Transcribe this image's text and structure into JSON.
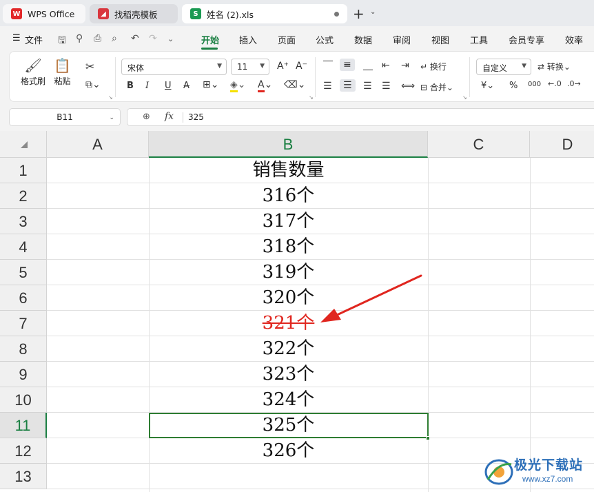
{
  "titlebar": {
    "tabs": [
      {
        "label": "WPS Office",
        "icon": "wps-logo-icon"
      },
      {
        "label": "找稻壳模板",
        "icon": "docer-icon"
      },
      {
        "label": "姓名 (2).xls",
        "icon": "spreadsheet-icon",
        "badge": "S"
      }
    ],
    "add_tab": "+"
  },
  "menubar": {
    "file": "文件",
    "items": [
      "开始",
      "插入",
      "页面",
      "公式",
      "数据",
      "审阅",
      "视图",
      "工具",
      "会员专享",
      "效率"
    ],
    "active": "开始"
  },
  "ribbon": {
    "format_painter": "格式刷",
    "paste": "粘贴",
    "font_name": "宋体",
    "font_size": "11",
    "wrap_text": "换行",
    "merge": "合并",
    "number_format": "自定义",
    "convert": "转换",
    "bold": "B",
    "italic": "I",
    "underline": "U",
    "font_color_letter": "A",
    "currency": "¥",
    "percent": "%",
    "thousands": "000"
  },
  "formula_bar": {
    "name_box": "B11",
    "fx": "fx",
    "value": "325"
  },
  "sheet": {
    "columns": [
      "A",
      "B",
      "C",
      "D"
    ],
    "selected_column": "B",
    "rows": [
      "1",
      "2",
      "3",
      "4",
      "5",
      "6",
      "7",
      "8",
      "9",
      "10",
      "11",
      "12",
      "13"
    ],
    "selected_row": "11",
    "column_b": [
      "销售数量",
      "316个",
      "317个",
      "318个",
      "319个",
      "320个",
      "321个",
      "322个",
      "323个",
      "324个",
      "325个",
      "326个",
      ""
    ],
    "strikethrough_row": "7",
    "strike_color": "#e0261f",
    "accent_color": "#1a7f42"
  },
  "watermark": {
    "title": "极光下载站",
    "url": "www.xz7.com"
  }
}
